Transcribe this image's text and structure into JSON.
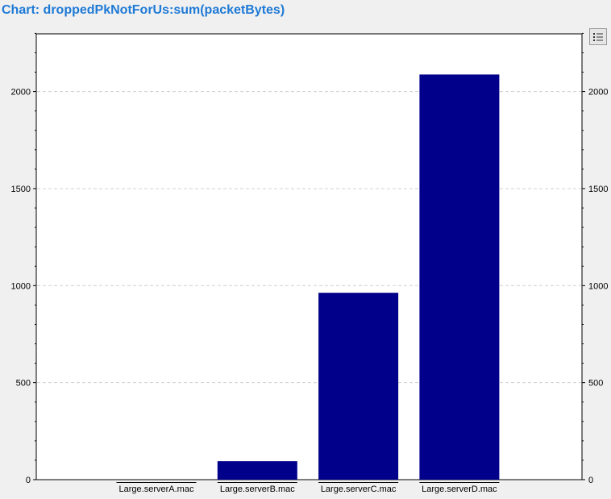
{
  "title": "Chart: droppedPkNotForUs:sum(packetBytes)",
  "legend_button": {
    "icon": "legend-list-icon"
  },
  "colors": {
    "bar": "#00008b",
    "plot_background": "#ffffff",
    "grid": "#d0d0d0"
  },
  "chart_data": {
    "type": "bar",
    "categories": [
      "Large.serverA.mac",
      "Large.serverB.mac",
      "Large.serverC.mac",
      "Large.serverD.mac"
    ],
    "values": [
      0,
      95,
      963,
      2088
    ],
    "title": "Chart: droppedPkNotForUs:sum(packetBytes)",
    "xlabel": "",
    "ylabel": "",
    "ylim": [
      0,
      2300
    ],
    "yticks": [
      0,
      500,
      1000,
      1500,
      2000
    ],
    "grid": true,
    "grid_style": "dashed horizontal",
    "right_axis": true
  }
}
